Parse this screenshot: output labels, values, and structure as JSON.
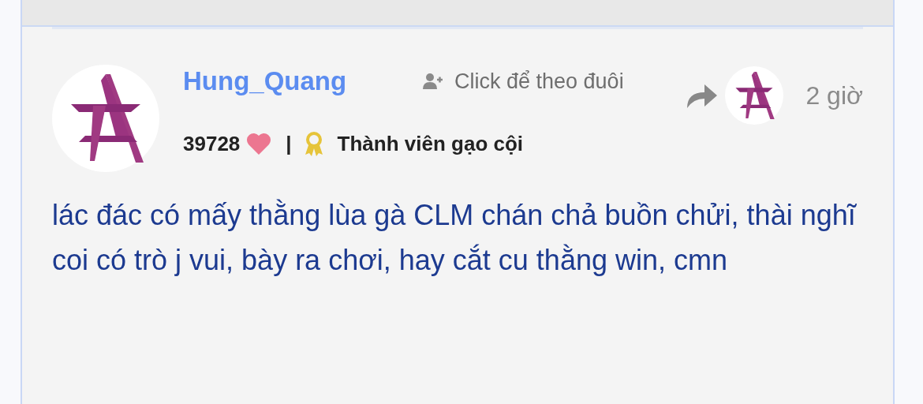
{
  "post": {
    "author": "Hung_Quang",
    "follow": "Click để theo đuôi",
    "time": "2 giờ",
    "likes": "39728",
    "separator": "|",
    "rank": "Thành viên gạo cội",
    "body": "lác đác có mấy thằng lùa gà CLM chán chả buồn chửi, thài nghĩ coi có trò j vui, bày ra chơi, hay cắt cu thằng win, cmn"
  }
}
